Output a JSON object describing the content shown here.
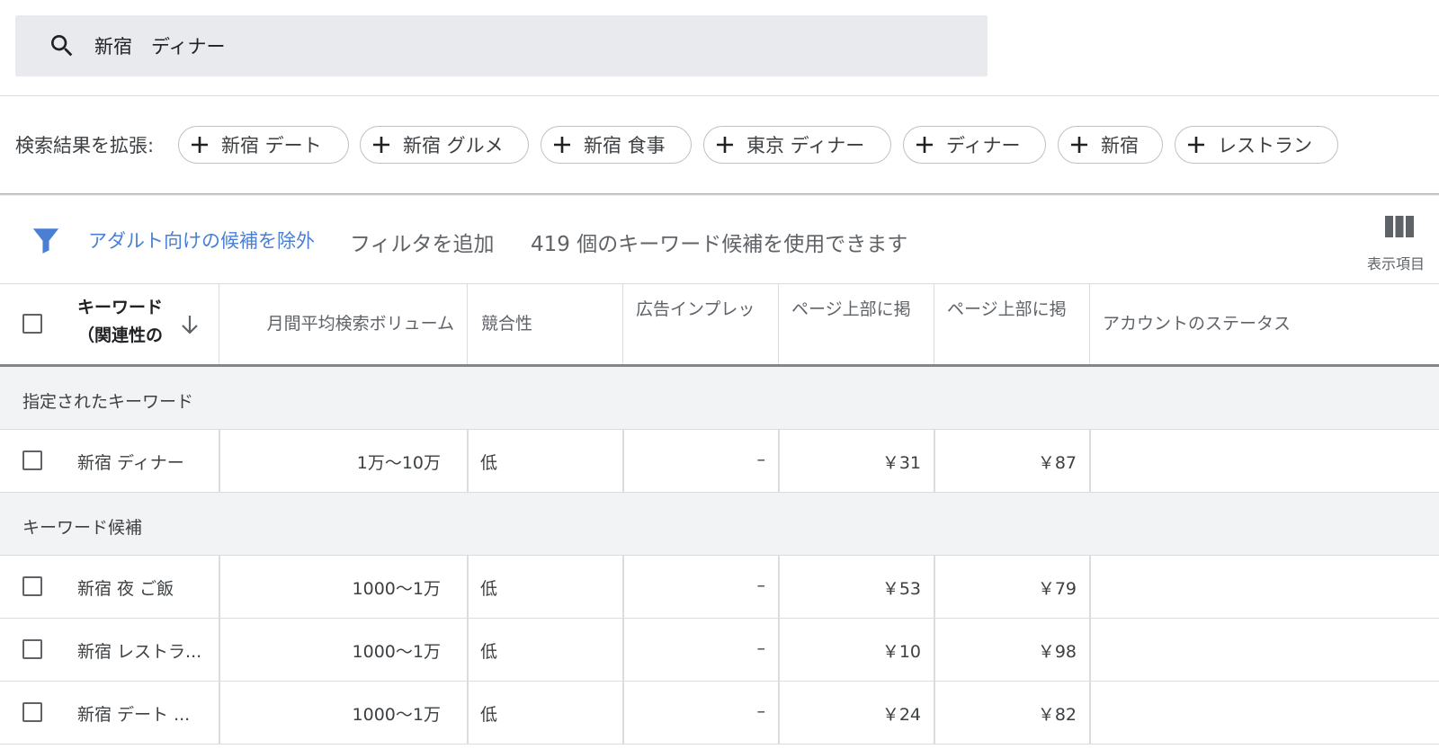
{
  "search": {
    "value": "新宿　ディナー"
  },
  "expand": {
    "label": "検索結果を拡張:",
    "chips": [
      "新宿 デート",
      "新宿 グルメ",
      "新宿 食事",
      "東京 ディナー",
      "ディナー",
      "新宿",
      "レストラン"
    ]
  },
  "filter": {
    "adult_filter": "アダルト向けの候補を除外",
    "add_filter": "フィルタを追加",
    "count_text": "419 個のキーワード候補を使用できます",
    "columns_label": "表示項目"
  },
  "table": {
    "headers": {
      "keyword_line1": "キーワード",
      "keyword_line2": "（関連性の",
      "volume": "月間平均検索ボリューム",
      "competition": "競合性",
      "impressions": "広告インプレッ",
      "top_bid_low": "ページ上部に掲",
      "top_bid_high": "ページ上部に掲",
      "status": "アカウントのステータス"
    },
    "group_provided": "指定されたキーワード",
    "provided_rows": [
      {
        "keyword": "新宿 ディナー",
        "volume": "1万～10万",
        "competition": "低",
        "impressions": "–",
        "bid_low": "￥31",
        "bid_high": "￥87",
        "status": ""
      }
    ],
    "group_ideas": "キーワード候補",
    "idea_rows": [
      {
        "keyword": "新宿 夜 ご飯",
        "volume": "1000～1万",
        "competition": "低",
        "impressions": "–",
        "bid_low": "￥53",
        "bid_high": "￥79",
        "status": ""
      },
      {
        "keyword": "新宿 レストラ...",
        "volume": "1000～1万",
        "competition": "低",
        "impressions": "–",
        "bid_low": "￥10",
        "bid_high": "￥98",
        "status": ""
      },
      {
        "keyword": "新宿 デート ...",
        "volume": "1000～1万",
        "competition": "低",
        "impressions": "–",
        "bid_low": "￥24",
        "bid_high": "￥82",
        "status": ""
      }
    ]
  },
  "colors": {
    "link": "#4a7fd4",
    "filter_icon": "#4a7fd4",
    "group_bg": "#f1f3f4",
    "search_bg": "#e8eaed"
  }
}
